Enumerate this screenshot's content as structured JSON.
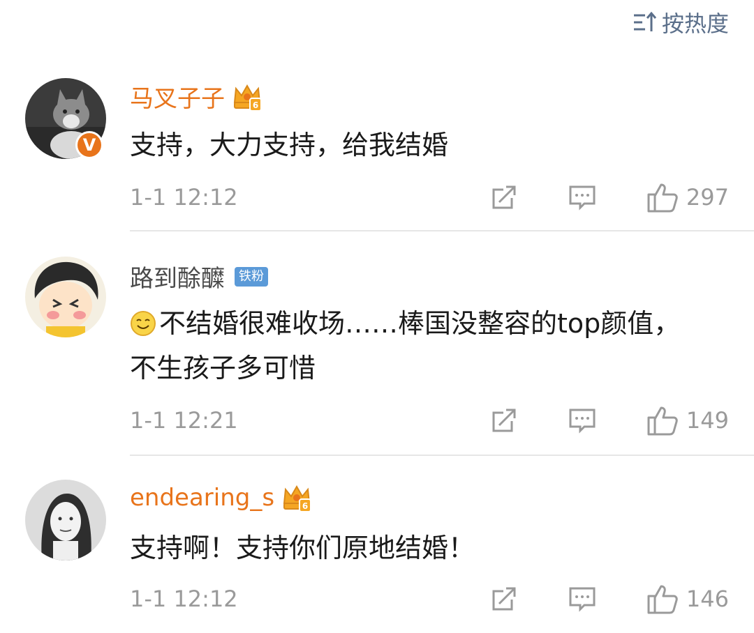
{
  "sort": {
    "label": "按热度",
    "icon": "sort-icon"
  },
  "comments": [
    {
      "username": "马叉子子",
      "user_style": "vip",
      "level_badge": "6",
      "verified_badge": "V",
      "content": "支持，大力支持，给我结婚",
      "time": "1-1 12:12",
      "likes": "297"
    },
    {
      "username": "路到酴醾",
      "user_style": "normal",
      "fan_badge": "铁粉",
      "content": "不结婚很难收场……棒国没整容的top颜值，不生孩子多可惜",
      "content_emoji": "smiley-emoji",
      "time": "1-1 12:21",
      "likes": "149"
    },
    {
      "username": "endearing_s",
      "user_style": "vip",
      "level_badge": "6",
      "content": "支持啊！支持你们原地结婚！",
      "time": "1-1 12:12",
      "likes": "146"
    }
  ],
  "colors": {
    "vip_name": "#e8741b",
    "sort": "#5b6f8a",
    "meta": "#9a9a9a",
    "fan_badge": "#5b9ad8"
  }
}
